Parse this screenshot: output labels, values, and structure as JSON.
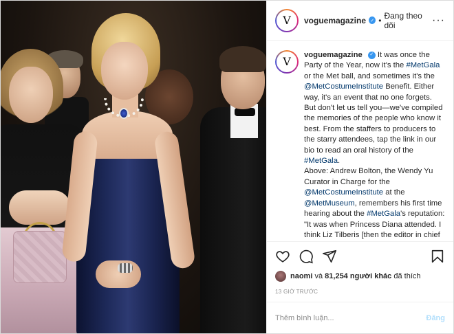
{
  "header": {
    "username": "voguemagazine",
    "avatar_letter": "V",
    "separator": "•",
    "follow_label": "Đang theo dõi",
    "more_label": "···"
  },
  "caption": {
    "username": "voguemagazine",
    "segments": [
      {
        "type": "text",
        "text": "It was once the Party of the Year, now it's the "
      },
      {
        "type": "link",
        "text": "#MetGala"
      },
      {
        "type": "text",
        "text": " or the Met ball, and sometimes it's the "
      },
      {
        "type": "link",
        "text": "@MetCostumeInstitute"
      },
      {
        "type": "text",
        "text": " Benefit. Either way, it's an event that no one forgets. But don't let us tell you—we've compiled the memories of the people who know it best. From the staffers to producers to the starry attendees, tap the link in our bio to read an oral history of the "
      },
      {
        "type": "link",
        "text": "#MetGala"
      },
      {
        "type": "text",
        "text": "."
      },
      {
        "type": "break"
      },
      {
        "type": "text",
        "text": "Above: Andrew Bolton, the Wendy Yu Curator in Charge for the "
      },
      {
        "type": "link",
        "text": "@MetCostumeInstitute"
      },
      {
        "type": "text",
        "text": " at the "
      },
      {
        "type": "link",
        "text": "@MetMuseum"
      },
      {
        "type": "text",
        "text": ", remembers his first time hearing about the "
      },
      {
        "type": "link",
        "text": "#MetGala"
      },
      {
        "type": "text",
        "text": "'s reputation: \"It was when Princess Diana attended. I think Liz Tilberis [then the editor in chief at Harper's"
      }
    ]
  },
  "likes": {
    "user": "naomi",
    "connector": "và",
    "count": "81,254",
    "others": "người khác",
    "suffix": "đã thích"
  },
  "timestamp": "13 GIỜ TRƯỚC",
  "comment": {
    "placeholder": "Thêm bình luận...",
    "post_label": "Đăng"
  },
  "colors": {
    "link": "#00376b",
    "verified": "#3897f0",
    "post_button_disabled": "#b2dffc",
    "muted": "#8e8e8e"
  },
  "icons": [
    "heart-icon",
    "comment-icon",
    "share-icon",
    "bookmark-icon",
    "verified-icon",
    "more-icon"
  ]
}
